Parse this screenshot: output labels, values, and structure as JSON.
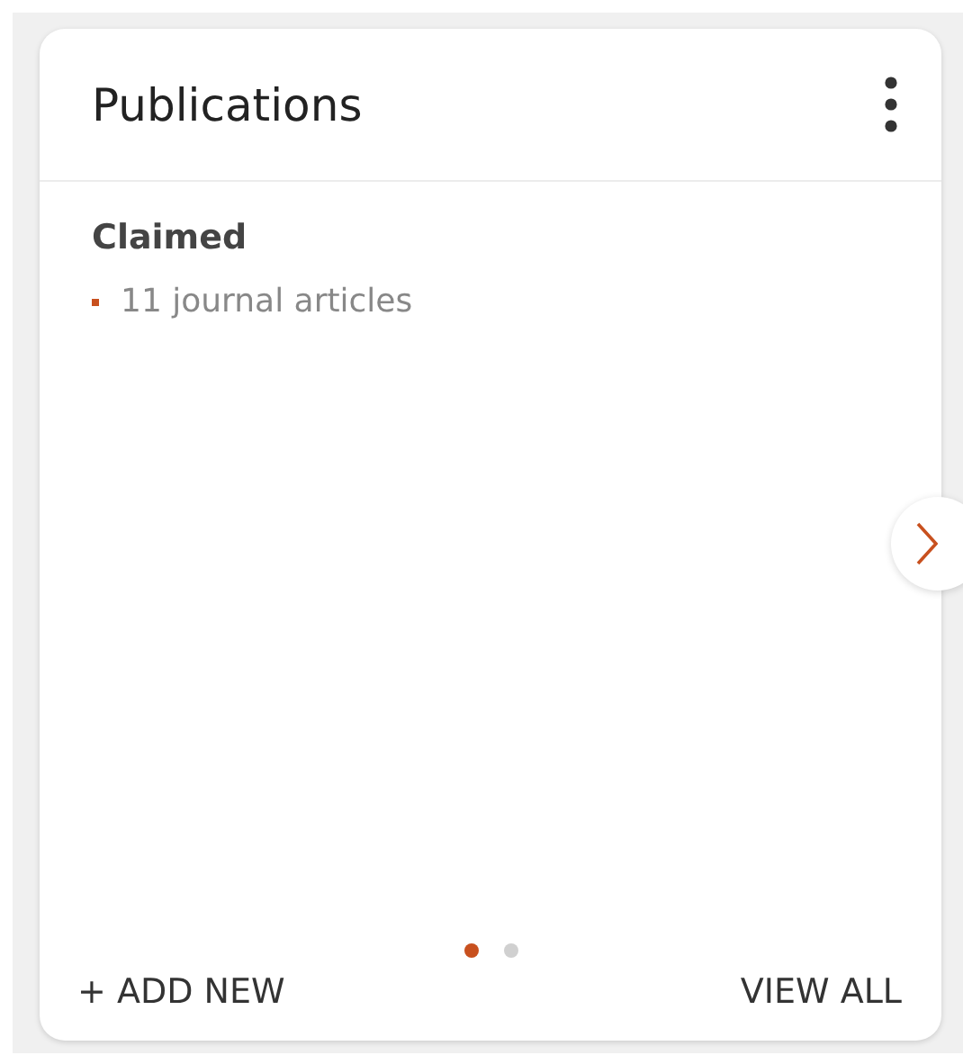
{
  "card": {
    "title": "Publications"
  },
  "section": {
    "heading": "Claimed",
    "items": [
      {
        "text": "11 journal articles"
      }
    ]
  },
  "pager": [
    {
      "selected": true
    },
    {
      "selected": false
    }
  ],
  "footer": {
    "add": "+ ADD NEW",
    "view_all": "VIEW ALL"
  }
}
